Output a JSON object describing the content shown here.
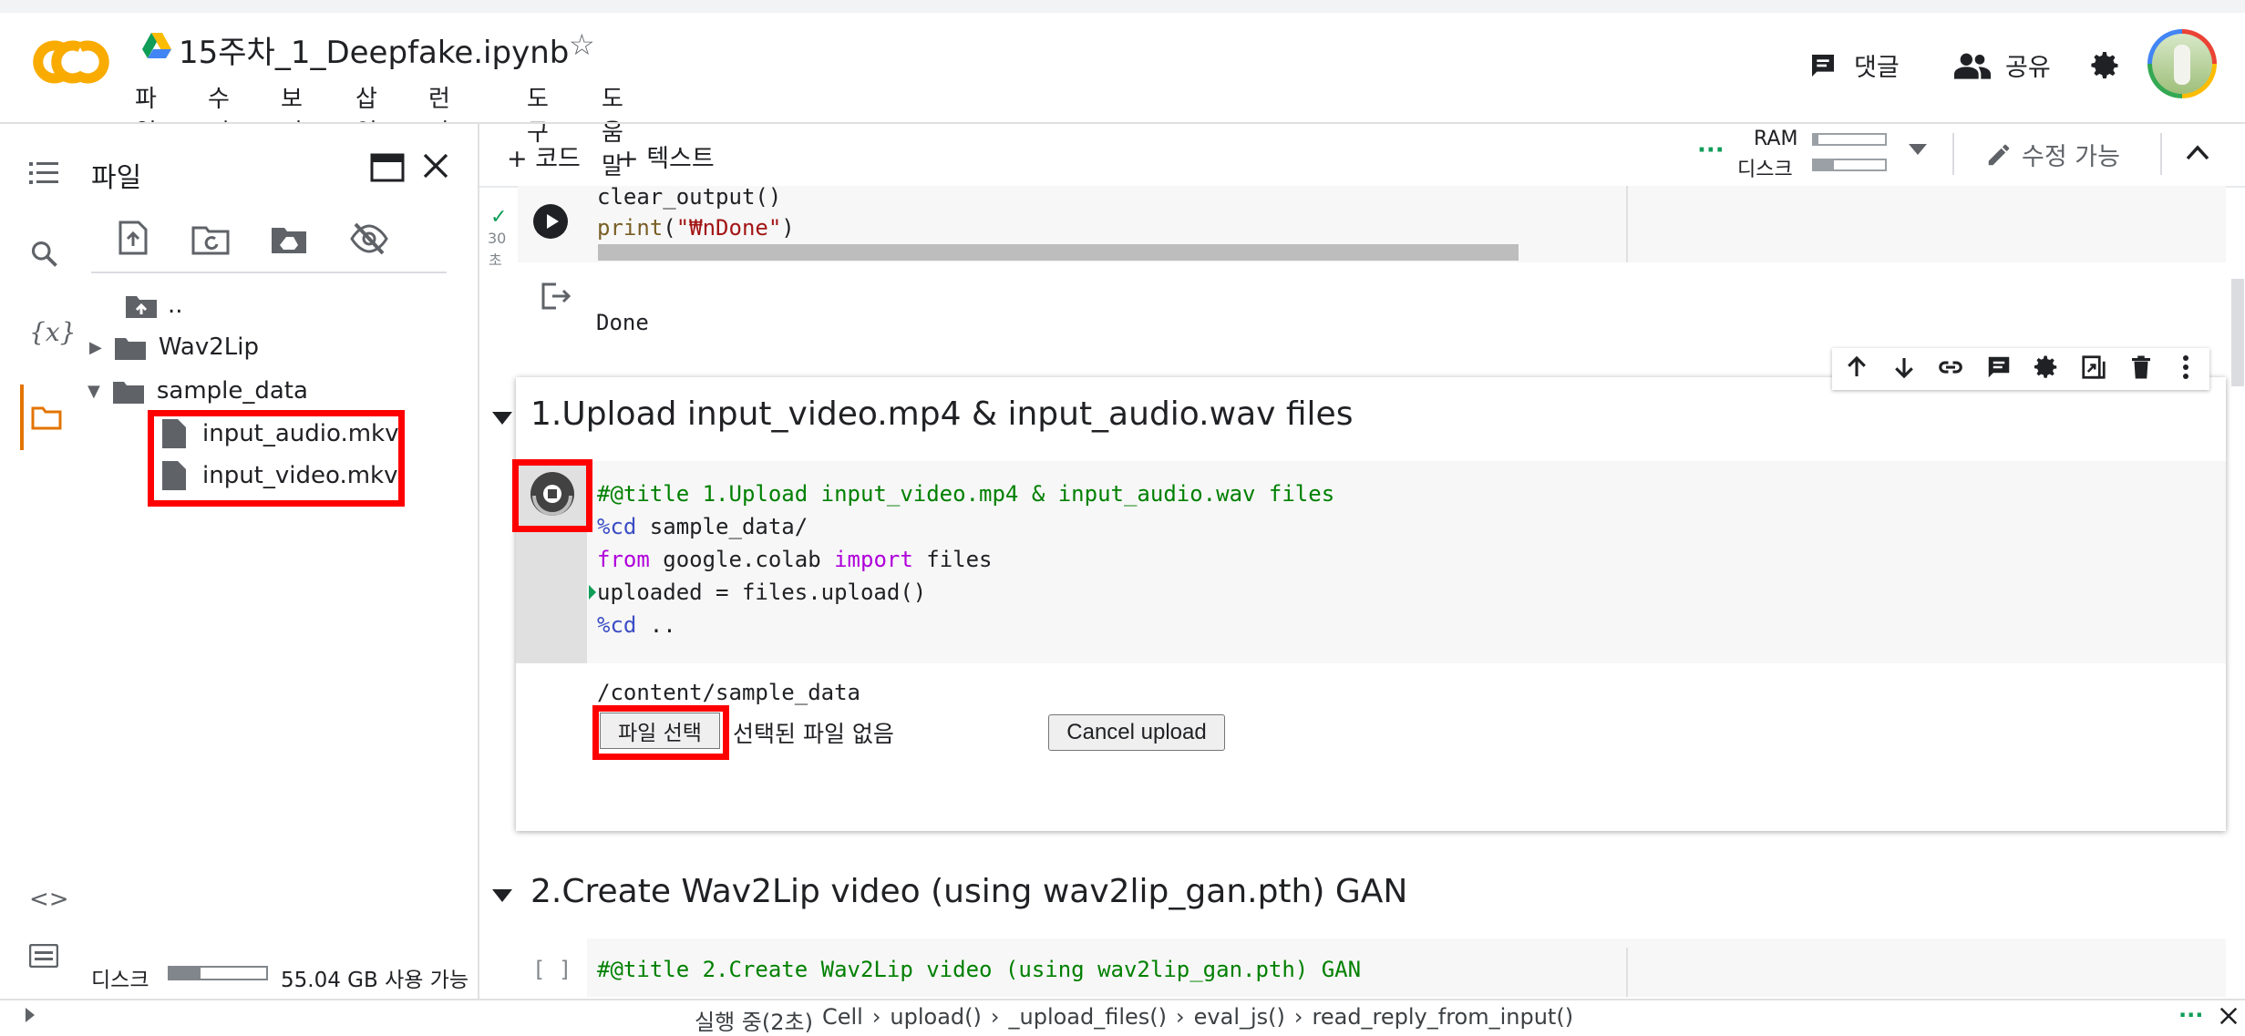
{
  "header": {
    "notebook_title": "15주차_1_Deepfake.ipynb",
    "menu": [
      "파일",
      "수정",
      "보기",
      "삽입",
      "런타임",
      "도구",
      "도움말"
    ],
    "comments_label": "댓글",
    "share_label": "공유"
  },
  "toolbar": {
    "add_code": "+ 코드",
    "add_text": "+ 텍스트",
    "ram_label": "RAM",
    "disk_label": "디스크",
    "edit_mode": "수정 가능"
  },
  "sidebar": {
    "title": "파일",
    "tree": [
      {
        "label": ".."
      },
      {
        "label": "Wav2Lip"
      },
      {
        "label": "sample_data"
      },
      {
        "label": "input_audio.mkv"
      },
      {
        "label": "input_video.mkv"
      }
    ],
    "disk_label": "디스크",
    "disk_free": "55.04 GB 사용 가능"
  },
  "cell_prev": {
    "exec_time_num": "30",
    "exec_time_unit": "초",
    "line1": "clear_output()",
    "line2_fn": "print",
    "line2_str": "\"₩nDone\"",
    "output": "Done"
  },
  "section1": {
    "title": "1.Upload input_video.mp4 & input_audio.wav files",
    "code": {
      "l1": "#@title 1.Upload input_video.mp4 & input_audio.wav files",
      "l2_magic": "%cd",
      "l2_rest": " sample_data/",
      "l3_from": "from",
      "l3_mid": " google.colab ",
      "l3_import": "import",
      "l3_rest": " files",
      "l4": "uploaded = files.upload()",
      "l5_magic": "%cd",
      "l5_rest": " .."
    },
    "output_path": "/content/sample_data",
    "choose_file": "파일 선택",
    "no_file": "선택된 파일 없음",
    "cancel_upload": "Cancel upload"
  },
  "section2": {
    "title": "2.Create Wav2Lip video (using wav2lip_gan.pth) GAN",
    "bracket": "[ ]",
    "code_l1": "#@title 2.Create Wav2Lip video (using wav2lip_gan.pth) GAN"
  },
  "statusbar": {
    "running": "실행 중(2초)",
    "trace": [
      "Cell",
      "upload()",
      "_upload_files()",
      "eval_js()",
      "read_reply_from_input()"
    ]
  },
  "colors": {
    "accent_orange": "#f9ab00",
    "highlight_red": "#ff0000",
    "green_ok": "#0f9d58"
  }
}
